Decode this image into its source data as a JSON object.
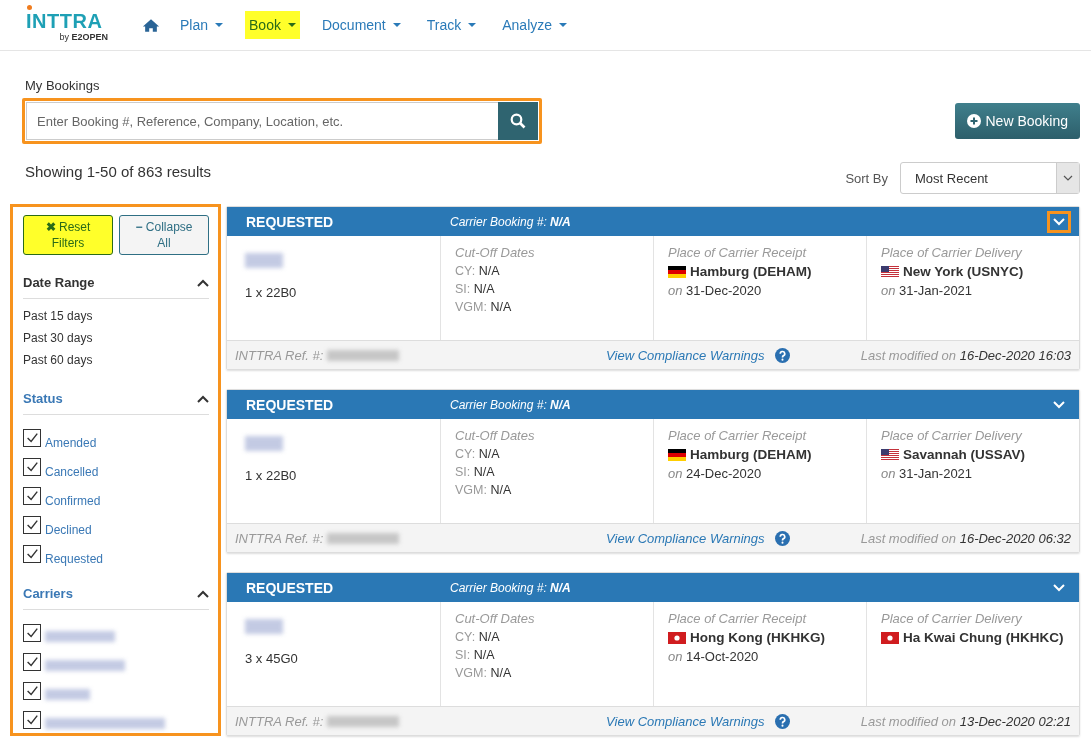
{
  "logo": {
    "name": "INTTRA",
    "by": "by",
    "company": "E2OPEN"
  },
  "nav": [
    {
      "label": "Plan",
      "selected": false
    },
    {
      "label": "Book",
      "selected": true
    },
    {
      "label": "Document",
      "selected": false
    },
    {
      "label": "Track",
      "selected": false
    },
    {
      "label": "Analyze",
      "selected": false
    }
  ],
  "page_title": "My Bookings",
  "search": {
    "placeholder": "Enter Booking #, Reference, Company, Location, etc.",
    "highlighted": true
  },
  "new_booking": "New Booking",
  "results": "Showing 1-50 of 863 results",
  "sort": {
    "label": "Sort By",
    "value": "Most Recent"
  },
  "filters": {
    "highlighted": true,
    "reset": {
      "icon": "✖",
      "label": "Reset Filters",
      "highlighted": true
    },
    "collapse": {
      "icon": "−",
      "label": "Collapse All"
    },
    "date_range": {
      "title": "Date Range",
      "expanded": true,
      "options": [
        "Past 15 days",
        "Past 30 days",
        "Past 60 days"
      ]
    },
    "status": {
      "title": "Status",
      "expanded": true,
      "options": [
        {
          "label": "Amended",
          "checked": true
        },
        {
          "label": "Cancelled",
          "checked": true
        },
        {
          "label": "Confirmed",
          "checked": true
        },
        {
          "label": "Declined",
          "checked": true
        },
        {
          "label": "Requested",
          "checked": true
        }
      ]
    },
    "carriers": {
      "title": "Carriers",
      "expanded": true,
      "options": [
        {
          "checked": true
        },
        {
          "checked": true
        },
        {
          "checked": true
        },
        {
          "checked": true
        }
      ]
    }
  },
  "bookings": [
    {
      "status": "REQUESTED",
      "carrier_label": "Carrier Booking #:",
      "carrier_value": "N/A",
      "toggle_highlighted": true,
      "containers": "1 x 22B0",
      "cutoff_title": "Cut-Off Dates",
      "cutoffs": [
        {
          "label": "CY:",
          "value": "N/A"
        },
        {
          "label": "SI:",
          "value": "N/A"
        },
        {
          "label": "VGM:",
          "value": "N/A"
        }
      ],
      "receipt_title": "Place of Carrier Receipt",
      "receipt": {
        "kind": "de",
        "place": "Hamburg (DEHAM)",
        "on": "on",
        "date": "31-Dec-2020"
      },
      "delivery_title": "Place of Carrier Delivery",
      "delivery": {
        "kind": "us",
        "place": "New York (USNYC)",
        "on": "on",
        "date": "31-Jan-2021"
      },
      "ref_label": "INTTRA Ref. #:",
      "warnings": "View Compliance Warnings",
      "modified_label": "Last modified on",
      "modified": "16-Dec-2020 16:03"
    },
    {
      "status": "REQUESTED",
      "carrier_label": "Carrier Booking #:",
      "carrier_value": "N/A",
      "toggle_highlighted": false,
      "containers": "1 x 22B0",
      "cutoff_title": "Cut-Off Dates",
      "cutoffs": [
        {
          "label": "CY:",
          "value": "N/A"
        },
        {
          "label": "SI:",
          "value": "N/A"
        },
        {
          "label": "VGM:",
          "value": "N/A"
        }
      ],
      "receipt_title": "Place of Carrier Receipt",
      "receipt": {
        "kind": "de",
        "place": "Hamburg (DEHAM)",
        "on": "on",
        "date": "24-Dec-2020"
      },
      "delivery_title": "Place of Carrier Delivery",
      "delivery": {
        "kind": "us",
        "place": "Savannah (USSAV)",
        "on": "on",
        "date": "31-Jan-2021"
      },
      "ref_label": "INTTRA Ref. #:",
      "warnings": "View Compliance Warnings",
      "modified_label": "Last modified on",
      "modified": "16-Dec-2020 06:32"
    },
    {
      "status": "REQUESTED",
      "carrier_label": "Carrier Booking #:",
      "carrier_value": "N/A",
      "toggle_highlighted": false,
      "containers": "3 x 45G0",
      "cutoff_title": "Cut-Off Dates",
      "cutoffs": [
        {
          "label": "CY:",
          "value": "N/A"
        },
        {
          "label": "SI:",
          "value": "N/A"
        },
        {
          "label": "VGM:",
          "value": "N/A"
        }
      ],
      "receipt_title": "Place of Carrier Receipt",
      "receipt": {
        "kind": "hk",
        "place": "Hong Kong (HKHKG)",
        "on": "on",
        "date": "14-Oct-2020"
      },
      "delivery_title": "Place of Carrier Delivery",
      "delivery": {
        "kind": "hk",
        "place": "Ha Kwai Chung (HKHKC)"
      },
      "ref_label": "INTTRA Ref. #:",
      "warnings": "View Compliance Warnings",
      "modified_label": "Last modified on",
      "modified": "13-Dec-2020 02:21"
    }
  ]
}
